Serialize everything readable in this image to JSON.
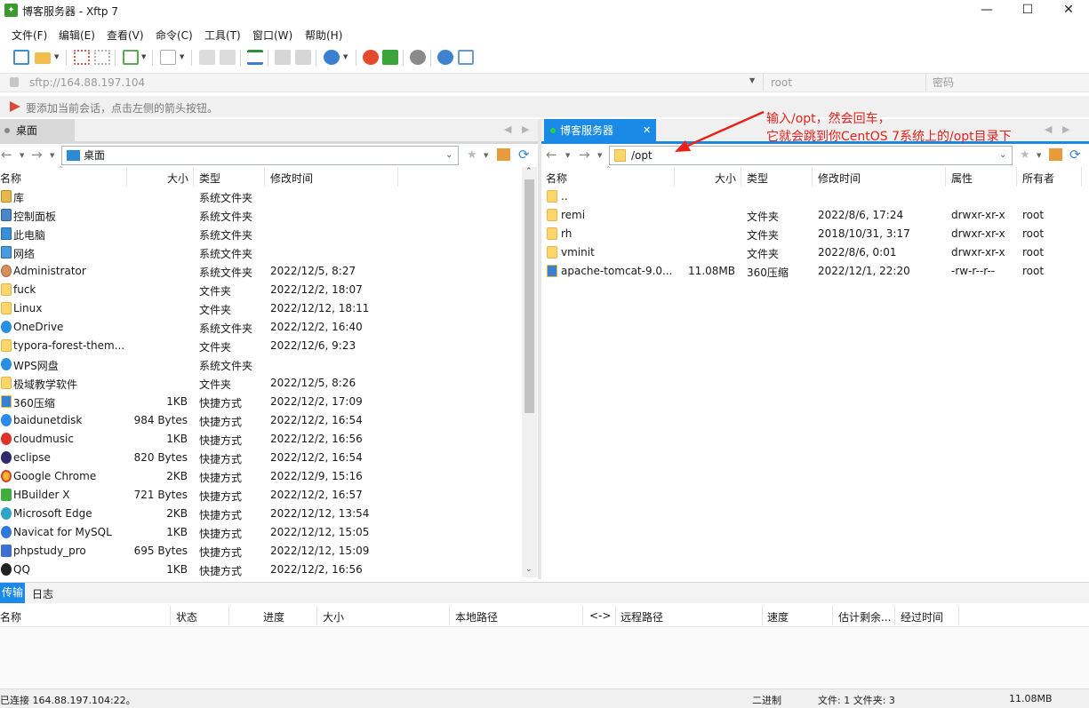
{
  "window": {
    "title": "博客服务器 - Xftp 7",
    "minimize": "—",
    "maximize": "☐",
    "close": "✕"
  },
  "menu": [
    "文件(F)",
    "编辑(E)",
    "查看(V)",
    "命令(C)",
    "工具(T)",
    "窗口(W)",
    "帮助(H)"
  ],
  "address": {
    "url": "sftp://164.88.197.104",
    "user_placeholder": "root",
    "password_placeholder": "密码"
  },
  "hint": "要添加当前会话，点击左侧的箭头按钮。",
  "left": {
    "tab": "桌面",
    "path": "桌面",
    "columns": [
      "名称",
      "大小",
      "类型",
      "修改时间"
    ],
    "rows": [
      {
        "name": "库",
        "size": "",
        "type": "系统文件夹",
        "mtime": "",
        "icon": "library-icon"
      },
      {
        "name": "控制面板",
        "size": "",
        "type": "系统文件夹",
        "mtime": "",
        "icon": "control-panel-icon"
      },
      {
        "name": "此电脑",
        "size": "",
        "type": "系统文件夹",
        "mtime": "",
        "icon": "computer-icon"
      },
      {
        "name": "网络",
        "size": "",
        "type": "系统文件夹",
        "mtime": "",
        "icon": "network-icon"
      },
      {
        "name": "Administrator",
        "size": "",
        "type": "系统文件夹",
        "mtime": "2022/12/5, 8:27",
        "icon": "user-icon"
      },
      {
        "name": "fuck",
        "size": "",
        "type": "文件夹",
        "mtime": "2022/12/2, 18:07",
        "icon": "folder-icon"
      },
      {
        "name": "Linux",
        "size": "",
        "type": "文件夹",
        "mtime": "2022/12/12, 18:11",
        "icon": "folder-icon"
      },
      {
        "name": "OneDrive",
        "size": "",
        "type": "系统文件夹",
        "mtime": "2022/12/2, 16:40",
        "icon": "cloud-icon"
      },
      {
        "name": "typora-forest-them...",
        "size": "",
        "type": "文件夹",
        "mtime": "2022/12/6, 9:23",
        "icon": "folder-icon"
      },
      {
        "name": "WPS网盘",
        "size": "",
        "type": "系统文件夹",
        "mtime": "",
        "icon": "cloud-icon"
      },
      {
        "name": "极域教学软件",
        "size": "",
        "type": "文件夹",
        "mtime": "2022/12/5, 8:26",
        "icon": "folder-icon"
      },
      {
        "name": "360压缩",
        "size": "1KB",
        "type": "快捷方式",
        "mtime": "2022/12/2, 17:09",
        "icon": "archive-icon"
      },
      {
        "name": "baidunetdisk",
        "size": "984 Bytes",
        "type": "快捷方式",
        "mtime": "2022/12/2, 16:54",
        "icon": "baidu-icon"
      },
      {
        "name": "cloudmusic",
        "size": "1KB",
        "type": "快捷方式",
        "mtime": "2022/12/2, 16:56",
        "icon": "music-icon"
      },
      {
        "name": "eclipse",
        "size": "820 Bytes",
        "type": "快捷方式",
        "mtime": "2022/12/2, 16:54",
        "icon": "eclipse-icon"
      },
      {
        "name": "Google Chrome",
        "size": "2KB",
        "type": "快捷方式",
        "mtime": "2022/12/9, 15:16",
        "icon": "chrome-icon"
      },
      {
        "name": "HBuilder X",
        "size": "721 Bytes",
        "type": "快捷方式",
        "mtime": "2022/12/2, 16:57",
        "icon": "hbuilder-icon"
      },
      {
        "name": "Microsoft Edge",
        "size": "2KB",
        "type": "快捷方式",
        "mtime": "2022/12/12, 13:54",
        "icon": "edge-icon"
      },
      {
        "name": "Navicat for MySQL",
        "size": "1KB",
        "type": "快捷方式",
        "mtime": "2022/12/12, 15:05",
        "icon": "navicat-icon"
      },
      {
        "name": "phpstudy_pro",
        "size": "695 Bytes",
        "type": "快捷方式",
        "mtime": "2022/12/12, 15:09",
        "icon": "phpstudy-icon"
      },
      {
        "name": "QQ",
        "size": "1KB",
        "type": "快捷方式",
        "mtime": "2022/12/2, 16:56",
        "icon": "qq-icon"
      }
    ]
  },
  "right": {
    "tab": "博客服务器",
    "path": "/opt",
    "columns": [
      "名称",
      "大小",
      "类型",
      "修改时间",
      "属性",
      "所有者"
    ],
    "rows": [
      {
        "name": "..",
        "size": "",
        "type": "",
        "mtime": "",
        "attr": "",
        "owner": "",
        "icon": "folder-icon"
      },
      {
        "name": "remi",
        "size": "",
        "type": "文件夹",
        "mtime": "2022/8/6, 17:24",
        "attr": "drwxr-xr-x",
        "owner": "root",
        "icon": "folder-icon"
      },
      {
        "name": "rh",
        "size": "",
        "type": "文件夹",
        "mtime": "2018/10/31, 3:17",
        "attr": "drwxr-xr-x",
        "owner": "root",
        "icon": "folder-icon"
      },
      {
        "name": "vminit",
        "size": "",
        "type": "文件夹",
        "mtime": "2022/8/6, 0:01",
        "attr": "drwxr-xr-x",
        "owner": "root",
        "icon": "folder-icon"
      },
      {
        "name": "apache-tomcat-9.0....",
        "size": "11.08MB",
        "type": "360压缩",
        "mtime": "2022/12/1, 22:20",
        "attr": "-rw-r--r--",
        "owner": "root",
        "icon": "archive-icon"
      }
    ]
  },
  "annotation": {
    "line1": "输入/opt，然会回车，",
    "line2": "它就会跳到你CentOS 7系统上的/opt目录下",
    "color": "#e8211a"
  },
  "transfer": {
    "tabs": [
      "传输",
      "日志"
    ],
    "columns": [
      "名称",
      "状态",
      "进度",
      "大小",
      "本地路径",
      "<->",
      "远程路径",
      "速度",
      "估计剩余...",
      "经过时间"
    ]
  },
  "status": {
    "connection": "已连接 164.88.197.104:22。",
    "mode": "二进制",
    "counts": "文件: 1  文件夹: 3",
    "size": "11.08MB"
  },
  "colors": {
    "accent": "#0e7ad1",
    "tab_active": "#1a8ae6",
    "annotation": "#e8211a"
  }
}
